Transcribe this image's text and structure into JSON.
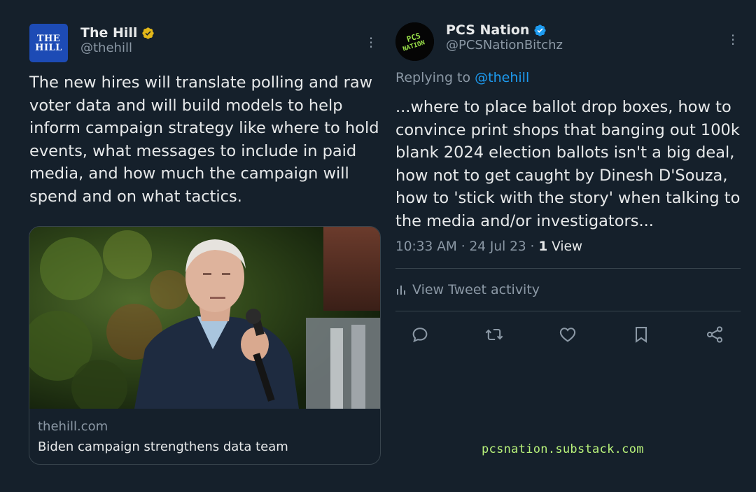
{
  "left_tweet": {
    "logo_line1": "THE",
    "logo_line2": "HILL",
    "display_name": "The Hill",
    "handle": "@thehill",
    "text": "The new hires will translate polling and raw voter data and will build models to help inform campaign strategy like where to hold events, what messages to include in paid media, and how much the campaign will spend and on what tactics.",
    "card": {
      "domain": "thehill.com",
      "title": "Biden campaign strengthens data team"
    },
    "badge_color": "#e2b719"
  },
  "right_tweet": {
    "avatar_text": "PCS NATION",
    "display_name": "PCS Nation",
    "handle": "@PCSNationBitchz",
    "replying_prefix": "Replying to",
    "replying_to": "@thehill",
    "text": "...where to place ballot drop boxes, how to convince print shops that banging out 100k blank 2024 election ballots isn't a big deal, how not to get caught by Dinesh D'Souza, how to 'stick with the story' when talking to the media and/or investigators...",
    "time": "10:33 AM",
    "date": "24 Jul 23",
    "views_count": "1",
    "views_label": "View",
    "activity_label": "View Tweet activity",
    "badge_color": "#1d9bf0",
    "actions": [
      "reply-icon",
      "retweet-icon",
      "like-icon",
      "bookmark-icon",
      "share-icon"
    ]
  },
  "watermark": "pcsnation.substack.com",
  "colors": {
    "background": "#15202b",
    "text": "#e7e9ea",
    "muted": "#8b98a5",
    "accent": "#1d9bf0",
    "watermark": "#b8f27a"
  }
}
